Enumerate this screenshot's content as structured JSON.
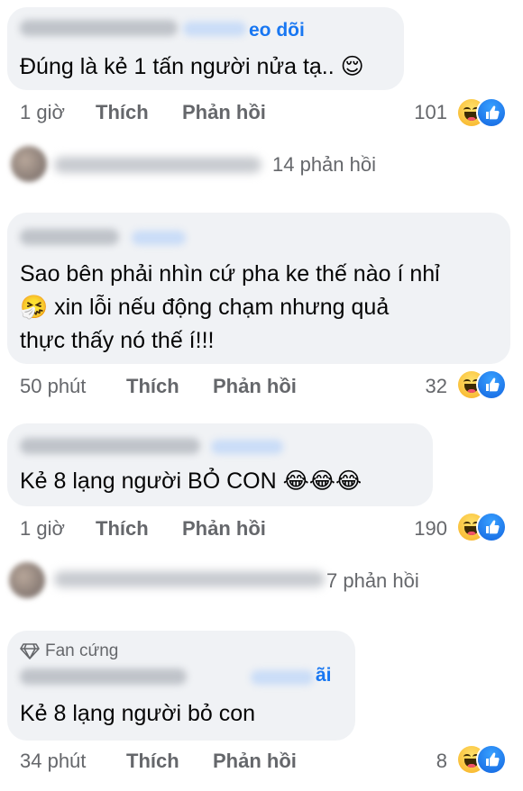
{
  "comments": [
    {
      "follow": "eo dõi",
      "text_lines": [
        "Đúng là kẻ 1 tấn người nửa tạ.. 😌"
      ],
      "time": "1 giờ",
      "like": "Thích",
      "reply": "Phản hồi",
      "count": "101"
    },
    {
      "text_lines": [
        "Sao bên phải nhìn cứ pha ke thế nào í nhỉ",
        "🤧 xin lỗi nếu động chạm nhưng quả",
        "thực thấy nó thế í!!!"
      ],
      "time": "50 phút",
      "like": "Thích",
      "reply": "Phản hồi",
      "count": "32"
    },
    {
      "text_lines": [
        "Kẻ 8 lạng người BỎ CON 😂😂😂"
      ],
      "time": "1 giờ",
      "like": "Thích",
      "reply": "Phản hồi",
      "count": "190"
    },
    {
      "badge": "Fan cứng",
      "follow": "ãi",
      "text_lines": [
        "Kẻ 8 lạng người bỏ con"
      ],
      "time": "34 phút",
      "like": "Thích",
      "reply": "Phản hồi",
      "count": "8"
    }
  ],
  "reply_threads": [
    {
      "text": "14 phản hồi"
    },
    {
      "text": "7 phản hồi"
    }
  ],
  "reactions": [
    "haha-icon",
    "like-icon"
  ],
  "colors": {
    "bubble": "#f0f2f5",
    "meta": "#65676b",
    "link": "#1877f2",
    "like": "#1877f2",
    "haha": "#f7b125"
  }
}
